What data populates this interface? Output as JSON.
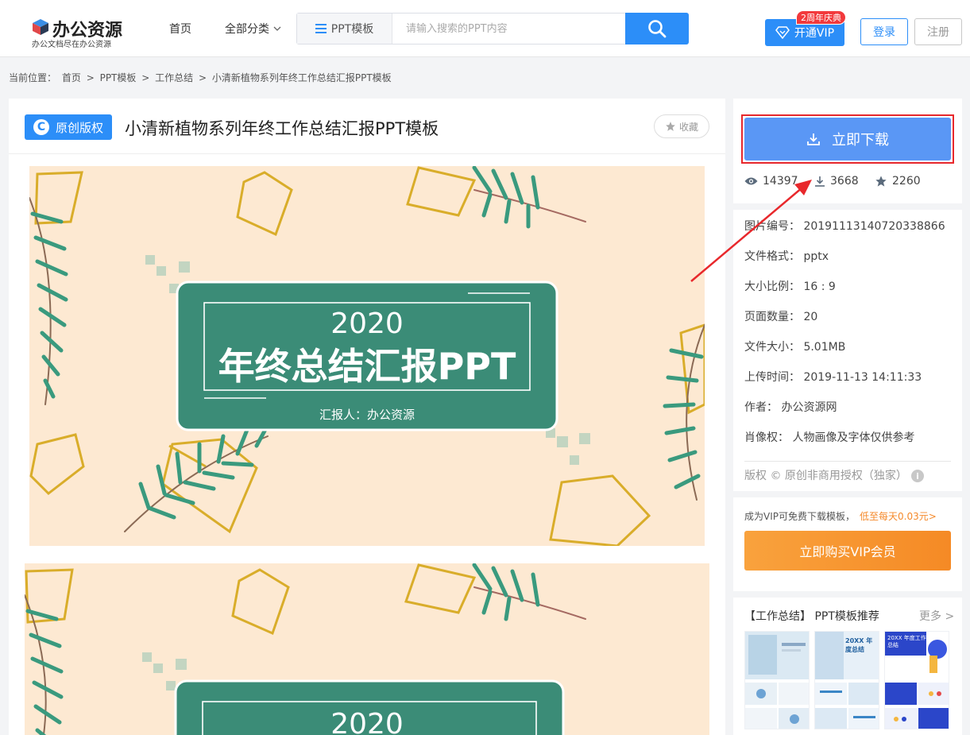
{
  "header": {
    "logo_title": "办公资源",
    "logo_subtitle": "办公文档尽在办公资源",
    "nav_home": "首页",
    "nav_categories": "全部分类",
    "search_category": "PPT模板",
    "search_placeholder": "请输入搜索的PPT内容",
    "vip_label": "开通VIP",
    "vip_badge": "2周年庆典",
    "login": "登录",
    "register": "注册",
    "colors": {
      "primary": "#2c8ef8",
      "badge": "#f2393c"
    }
  },
  "breadcrumb": {
    "prefix": "当前位置：",
    "items": [
      "首页",
      "PPT模板",
      "工作总结",
      "小清新植物系列年终工作总结汇报PPT模板"
    ],
    "separator": ">"
  },
  "main": {
    "badge": "原创版权",
    "title": "小清新植物系列年终工作总结汇报PPT模板",
    "favorite": "收藏",
    "slide": {
      "year": "2020",
      "headline": "年终总结汇报PPT",
      "reporter": "汇报人：办公资源",
      "colors": {
        "bg": "#fde9d2",
        "panel": "#3b8c77",
        "gold": "#d9ad2a",
        "leaf": "#3a9a7e"
      }
    }
  },
  "download": {
    "button": "立即下载",
    "views": "14397",
    "downloads": "3668",
    "favorites": "2260",
    "highlight_color": "#e8282c"
  },
  "info": {
    "rows": [
      {
        "label": "图片编号：",
        "value": "20191113140720338866"
      },
      {
        "label": "文件格式：",
        "value": "pptx"
      },
      {
        "label": "大小比例：",
        "value": "16 : 9"
      },
      {
        "label": "页面数量：",
        "value": "20"
      },
      {
        "label": "文件大小：",
        "value": "5.01MB"
      },
      {
        "label": "上传时间：",
        "value": "2019-11-13 14:11:33"
      },
      {
        "label": "作者：",
        "value": "办公资源网"
      },
      {
        "label": "肖像权：",
        "value": "人物画像及字体仅供参考"
      }
    ],
    "copyright": "版权 © 原创非商用授权（独家）"
  },
  "vip": {
    "promo": "成为VIP可免费下载模板，",
    "price": "低至每天0.03元>",
    "buy": "立即购买VIP会员"
  },
  "recommend": {
    "title": "【工作总结】 PPT模板推荐",
    "more": "更多 >",
    "thumb2_title": "20XX 年度总结",
    "thumb3_title": "20XX 年度工作总结"
  }
}
